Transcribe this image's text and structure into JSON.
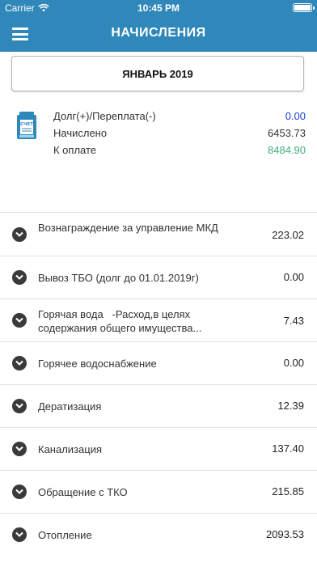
{
  "status_bar": {
    "carrier": "Carrier",
    "time": "10:45 PM"
  },
  "header": {
    "title": "НАЧИСЛЕНИЯ",
    "menu_icon": "hamburger-menu-icon"
  },
  "period": {
    "label": "ЯНВАРЬ 2019"
  },
  "summary": {
    "icon": "invoice-icon",
    "icon_text": "СЧЕТ",
    "debt_label": "Долг(+)/Переплата(-)",
    "debt_value": "0.00",
    "charged_label": "Начислено",
    "charged_value": "6453.73",
    "to_pay_label": "К оплате",
    "to_pay_value": "8484.90"
  },
  "colors": {
    "brand": "#2f87ba",
    "debt_value": "#1a3fd6",
    "to_pay_value": "#3fb07a"
  },
  "charges": [
    {
      "label": "Вознаграждение за управление МКД",
      "value": "223.02"
    },
    {
      "label": "Вывоз ТБО (долг до 01.01.2019г)",
      "value": "0.00"
    },
    {
      "label": "Горячая вода   -Расход,в целях содержания общего имущества...",
      "value": "7.43"
    },
    {
      "label": "Горячее водоснабжение",
      "value": "0.00"
    },
    {
      "label": "Дератизация",
      "value": "12.39"
    },
    {
      "label": "Канализация",
      "value": "137.40"
    },
    {
      "label": "Обращение с ТКО",
      "value": "215.85"
    },
    {
      "label": "Отопление",
      "value": "2093.53"
    }
  ]
}
